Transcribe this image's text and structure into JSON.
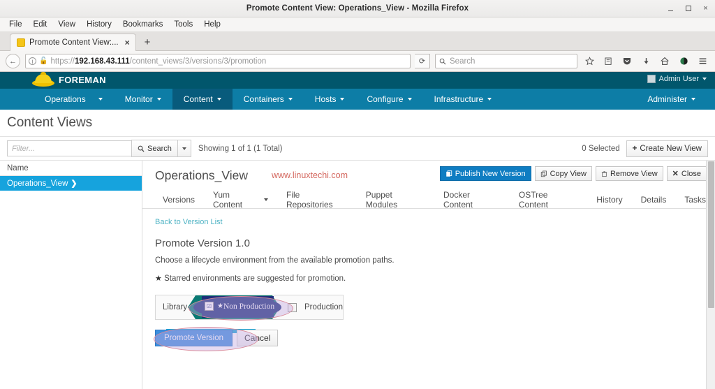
{
  "window": {
    "title": "Promote Content View: Operations_View - Mozilla Firefox",
    "minimize_label": "",
    "maximize_label": "",
    "close_label": "×"
  },
  "menubar": {
    "items": [
      "File",
      "Edit",
      "View",
      "History",
      "Bookmarks",
      "Tools",
      "Help"
    ]
  },
  "browser": {
    "tab": {
      "title": "Promote Content View:...",
      "close_label": "×",
      "favicon": "page-favicon"
    },
    "new_tab_label": "+",
    "back_label": "←",
    "reload_label": "⟳",
    "url_protocol": "https://",
    "url_host": "192.168.43.111",
    "url_path": "/content_views/3/versions/3/promotion",
    "search_placeholder": "Search",
    "toolbar_icons": [
      "bookmark-star-icon",
      "reader-icon",
      "pocket-icon",
      "downloads-icon",
      "home-icon",
      "sync-icon",
      "hamburger-menu-icon"
    ]
  },
  "foreman": {
    "brand": "FOREMAN",
    "user": "Admin User",
    "nav": [
      {
        "label": "Operations",
        "has_caret": true,
        "active": false
      },
      {
        "label": "Monitor",
        "has_caret": true,
        "active": false
      },
      {
        "label": "Content",
        "has_caret": true,
        "active": true
      },
      {
        "label": "Containers",
        "has_caret": true,
        "active": false
      },
      {
        "label": "Hosts",
        "has_caret": true,
        "active": false
      },
      {
        "label": "Configure",
        "has_caret": true,
        "active": false
      },
      {
        "label": "Infrastructure",
        "has_caret": true,
        "active": false
      }
    ],
    "administer": "Administer"
  },
  "page": {
    "title": "Content Views"
  },
  "toolbar": {
    "filter_placeholder": "Filter...",
    "search_label": "Search",
    "showing": "Showing 1 of 1 (1 Total)",
    "selected": "0 Selected",
    "create_label": "Create New View",
    "create_plus": "+"
  },
  "sidebar": {
    "column_header": "Name",
    "rows": [
      {
        "label": "Operations_View",
        "chevron": "❯",
        "selected": true
      }
    ]
  },
  "panel": {
    "title": "Operations_View",
    "watermark": "www.linuxtechi.com",
    "buttons": [
      {
        "label": "Publish New Version",
        "icon": "publish-icon",
        "primary": true
      },
      {
        "label": "Copy View",
        "icon": "copy-icon",
        "primary": false
      },
      {
        "label": "Remove View",
        "icon": "trash-icon",
        "primary": false
      },
      {
        "label": "Close",
        "icon": "close-x-icon",
        "primary": false
      }
    ],
    "tabs": [
      {
        "label": "Versions",
        "caret": false
      },
      {
        "label": "Yum Content",
        "caret": true
      },
      {
        "label": "File Repositories",
        "caret": false
      },
      {
        "label": "Puppet Modules",
        "caret": false
      },
      {
        "label": "Docker Content",
        "caret": false
      },
      {
        "label": "OSTree Content",
        "caret": false
      },
      {
        "label": "History",
        "caret": false
      },
      {
        "label": "Details",
        "caret": false
      },
      {
        "label": "Tasks",
        "caret": false
      }
    ]
  },
  "promote": {
    "back_link": "Back to Version List",
    "heading": "Promote Version 1.0",
    "description": "Choose a lifecycle environment from the available promotion paths.",
    "star_glyph": "★",
    "star_note": "Starred environments are suggested for promotion.",
    "environments": [
      {
        "name": "Library",
        "type": "plain",
        "checked": false,
        "starred": false
      },
      {
        "name": "Non Production",
        "type": "chevron",
        "checked": true,
        "starred": true,
        "star_glyph": "★",
        "check_glyph": "☑"
      },
      {
        "name": "Production",
        "type": "plain-checkbox",
        "checked": false,
        "starred": false
      }
    ],
    "promote_button": "Promote Version",
    "cancel_button": "Cancel"
  },
  "colors": {
    "foreman_brand_bar": "#01566c",
    "foreman_nav": "#0d7da6",
    "foreman_nav_active": "#085b7c",
    "sidebar_selected": "#16a3dd",
    "primary_button": "#0f7dc2",
    "promote_button": "#3b8ede",
    "env_chevron": "#0a7a74",
    "env_overlay_navy": "#1b2f7a",
    "annotation_outline": "#d98a9a",
    "annotation_fill": "#c4aae0",
    "watermark": "#d4685f",
    "link": "#4fb3c4"
  }
}
